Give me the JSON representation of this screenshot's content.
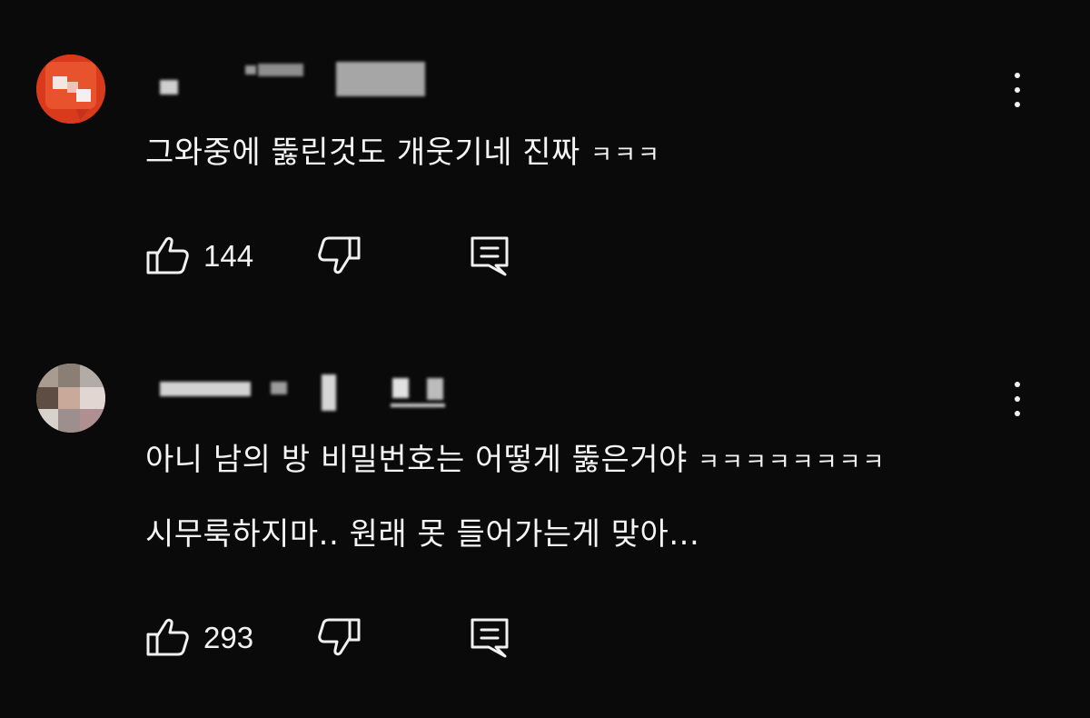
{
  "comments": [
    {
      "text_lines": [
        {
          "main": "그와중에 뚫린것도 개웃기네 진짜 ",
          "laugh": "ㅋㅋㅋ"
        }
      ],
      "like_count": "144",
      "avatar_color": "#e0401f"
    },
    {
      "text_lines": [
        {
          "main": "아니 남의 방 비밀번호는 어떻게 뚫은거야 ",
          "laugh": "ㅋㅋㅋㅋㅋㅋㅋㅋ"
        },
        {
          "main": "시무룩하지마.. 원래 못 들어가는게 맞아...",
          "laugh": ""
        }
      ],
      "like_count": "293",
      "avatar_color": "#8a7d74"
    }
  ],
  "icons": {
    "like": "thumbs-up-icon",
    "dislike": "thumbs-down-icon",
    "reply": "reply-comment-icon",
    "menu": "more-vertical-icon"
  }
}
